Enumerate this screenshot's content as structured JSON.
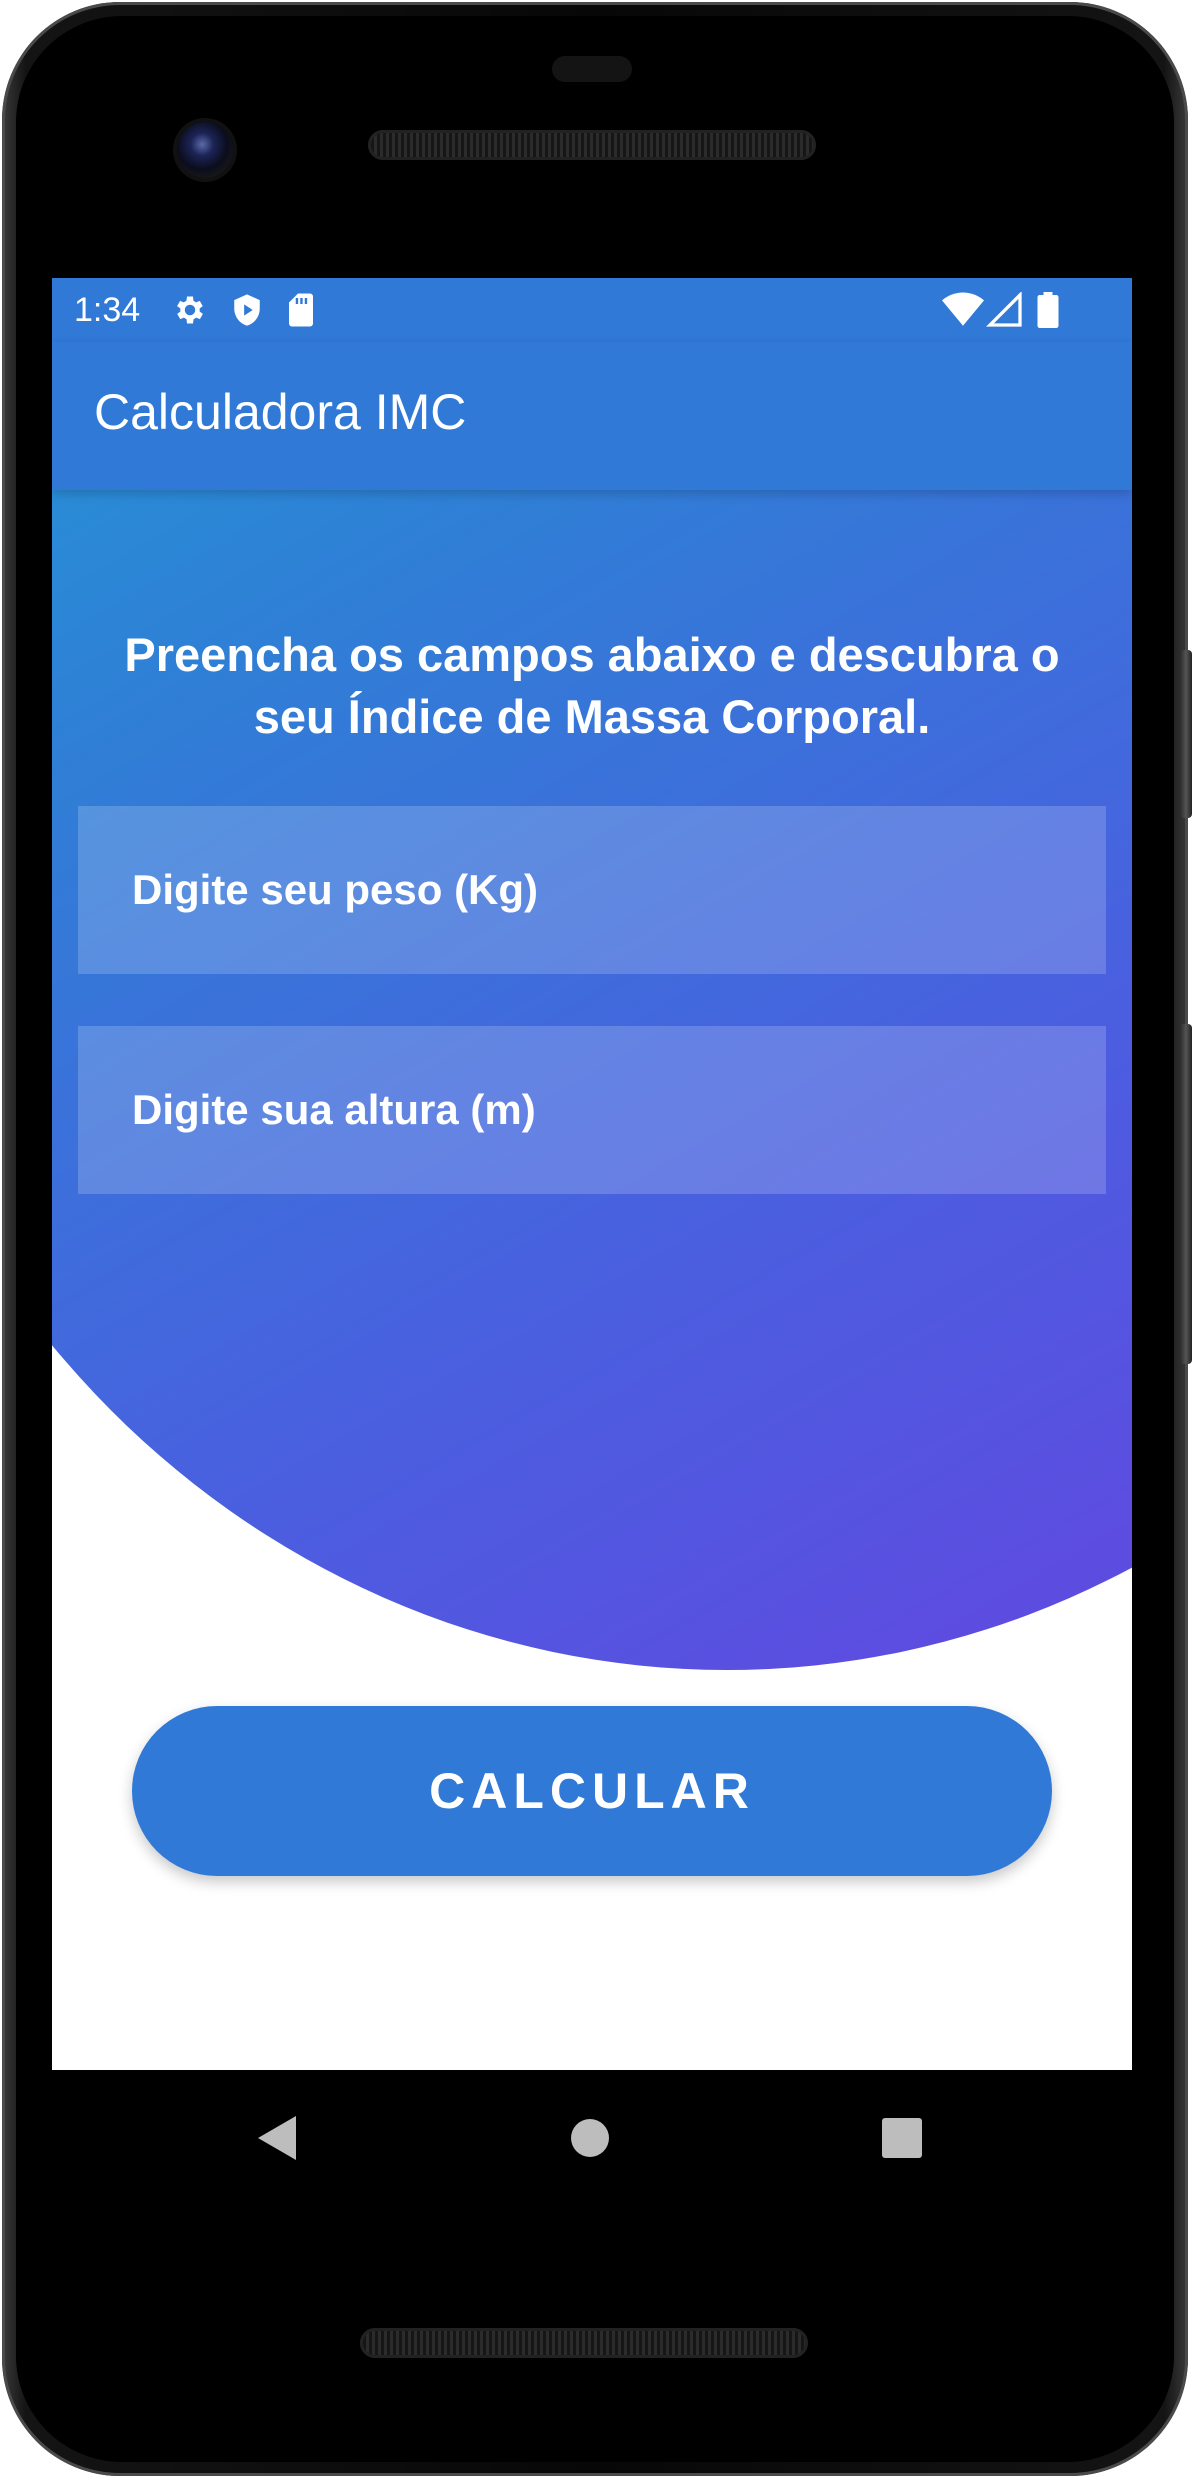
{
  "status_bar": {
    "time": "1:34",
    "left_icons": [
      "gear-icon",
      "shield-play-icon",
      "sd-card-icon"
    ],
    "right_icons": [
      "wifi-icon",
      "signal-icon",
      "battery-icon"
    ]
  },
  "app_bar": {
    "title": "Calculadora IMC"
  },
  "main": {
    "intro": "Preencha os campos abaixo e descubra o seu Índice de Massa Corporal.",
    "weight_field": {
      "placeholder": "Digite seu peso (Kg)",
      "value": ""
    },
    "height_field": {
      "placeholder": "Digite sua altura (m)",
      "value": ""
    },
    "calculate_label": "CALCULAR"
  },
  "nav_bar": {
    "icons": [
      "back-triangle-icon",
      "home-circle-icon",
      "recents-square-icon"
    ]
  },
  "colors": {
    "primary": "#3079d6",
    "gradient_start": "#19b2d8",
    "gradient_end": "#6a3fe0",
    "text_on_primary": "#ffffff"
  }
}
